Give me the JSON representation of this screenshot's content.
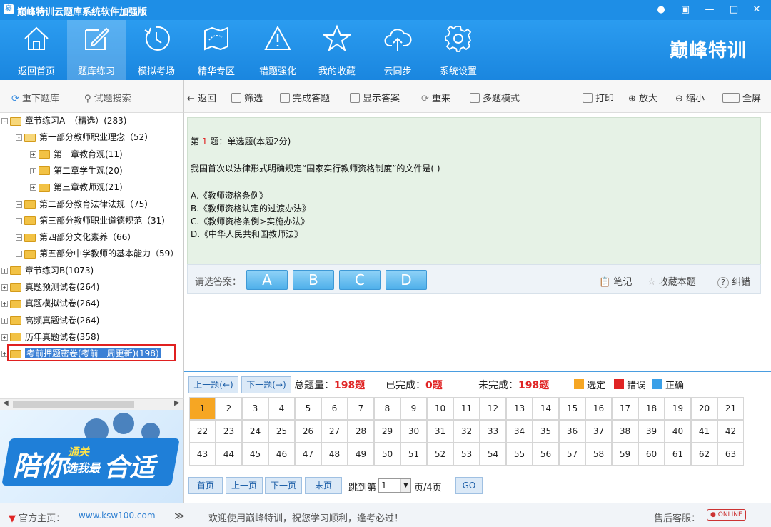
{
  "window": {
    "title": "巅峰特训云题库系统软件加强版"
  },
  "nav": {
    "items": [
      {
        "label": "返回首页",
        "icon": "home-icon"
      },
      {
        "label": "题库练习",
        "icon": "edit-icon",
        "active": true
      },
      {
        "label": "模拟考场",
        "icon": "clock-icon"
      },
      {
        "label": "精华专区",
        "icon": "map-icon"
      },
      {
        "label": "错题强化",
        "icon": "warning-icon"
      },
      {
        "label": "我的收藏",
        "icon": "star-icon"
      },
      {
        "label": "云同步",
        "icon": "cloud-upload-icon"
      },
      {
        "label": "系统设置",
        "icon": "gear-icon"
      }
    ],
    "brand": "巅峰特训"
  },
  "left": {
    "reload": "重下题库",
    "search": "试题搜索"
  },
  "tree": [
    {
      "label": "章节练习A　（精选）(283)",
      "level": 0,
      "exp": "-",
      "open": true
    },
    {
      "label": "第一部分教师职业理念（52）",
      "level": 1,
      "exp": "-",
      "open": true
    },
    {
      "label": "第一章教育观(11)",
      "level": 2,
      "exp": "+"
    },
    {
      "label": "第二章学生观(20)",
      "level": 2,
      "exp": "+"
    },
    {
      "label": "第三章教师观(21)",
      "level": 2,
      "exp": "+"
    },
    {
      "label": "第二部分教育法律法规（75）",
      "level": 1,
      "exp": "+"
    },
    {
      "label": "第三部分教师职业道德规范（31）",
      "level": 1,
      "exp": "+"
    },
    {
      "label": "第四部分文化素养（66）",
      "level": 1,
      "exp": "+"
    },
    {
      "label": "第五部分中学教师的基本能力（59）",
      "level": 1,
      "exp": "+"
    },
    {
      "label": "章节练习B(1073)",
      "level": 0,
      "exp": "+"
    },
    {
      "label": "真题预测试卷(264)",
      "level": 0,
      "exp": "+"
    },
    {
      "label": "真题模拟试卷(264)",
      "level": 0,
      "exp": "+"
    },
    {
      "label": "高频真题试卷(264)",
      "level": 0,
      "exp": "+"
    },
    {
      "label": "历年真题试卷(358)",
      "level": 0,
      "exp": "+"
    },
    {
      "label": "考前押题密卷(考前一周更新)(198)",
      "level": 0,
      "exp": "+",
      "selected": true
    }
  ],
  "banner": {
    "big": "陪你",
    "small": "通关",
    "small2": "选我最",
    "big2": "合适"
  },
  "rtool": {
    "back": "返回",
    "filter": "筛选",
    "finish": "完成答题",
    "show": "显示答案",
    "redo": "重来",
    "multi": "多题模式",
    "print": "打印",
    "zoomin": "放大",
    "zoomout": "缩小",
    "full": "全屏"
  },
  "question": {
    "prefix": "第",
    "num": "1",
    "suffix": "题：单选题(本题2分)",
    "stem": "我国首次以法律形式明确规定“国家实行教师资格制度”的文件是( )",
    "options": [
      "A.《教师资格条例》",
      "B.《教师资格认定的过渡办法》",
      "C.《教师资格条例>实施办法》",
      "D.《中华人民共和国教师法》"
    ]
  },
  "answer": {
    "label": "请选答案：",
    "choices": [
      "A",
      "B",
      "C",
      "D"
    ],
    "note": "笔记",
    "fav": "收藏本题",
    "report": "纠错"
  },
  "progress": {
    "prev": "上一题(←)",
    "next": "下一题(→)",
    "total_label": "总题量：",
    "total": "198题",
    "done_label": "已完成：",
    "done": "0题",
    "todo_label": "未完成：",
    "todo": "198题",
    "legend": [
      {
        "label": "选定",
        "color": "#f6a623"
      },
      {
        "label": "错误",
        "color": "#e02424"
      },
      {
        "label": "正确",
        "color": "#3aa0e8"
      }
    ]
  },
  "grid": {
    "numbers": [
      "1",
      "2",
      "3",
      "4",
      "5",
      "6",
      "7",
      "8",
      "9",
      "10",
      "11",
      "12",
      "13",
      "14",
      "15",
      "16",
      "17",
      "18",
      "19",
      "20",
      "21",
      "22",
      "23",
      "24",
      "25",
      "26",
      "27",
      "28",
      "29",
      "30",
      "31",
      "32",
      "33",
      "34",
      "35",
      "36",
      "37",
      "38",
      "39",
      "40",
      "41",
      "42",
      "43",
      "44",
      "45",
      "46",
      "47",
      "48",
      "49",
      "50",
      "51",
      "52",
      "53",
      "54",
      "55",
      "56",
      "57",
      "58",
      "59",
      "60",
      "61",
      "62",
      "63"
    ],
    "current": "1"
  },
  "pager": {
    "first": "首页",
    "prev": "上一页",
    "next": "下一页",
    "last": "末页",
    "jump": "跳到第",
    "page": "1",
    "of": "页/4页",
    "go": "GO"
  },
  "status": {
    "home_label": "官方主页：",
    "home_url": "www.ksw100.com",
    "arrow": "≫",
    "welcome": "欢迎使用巅峰特训，祝您学习顺利，逢考必过！",
    "service": "售后客服：",
    "online": "ONLINE"
  }
}
